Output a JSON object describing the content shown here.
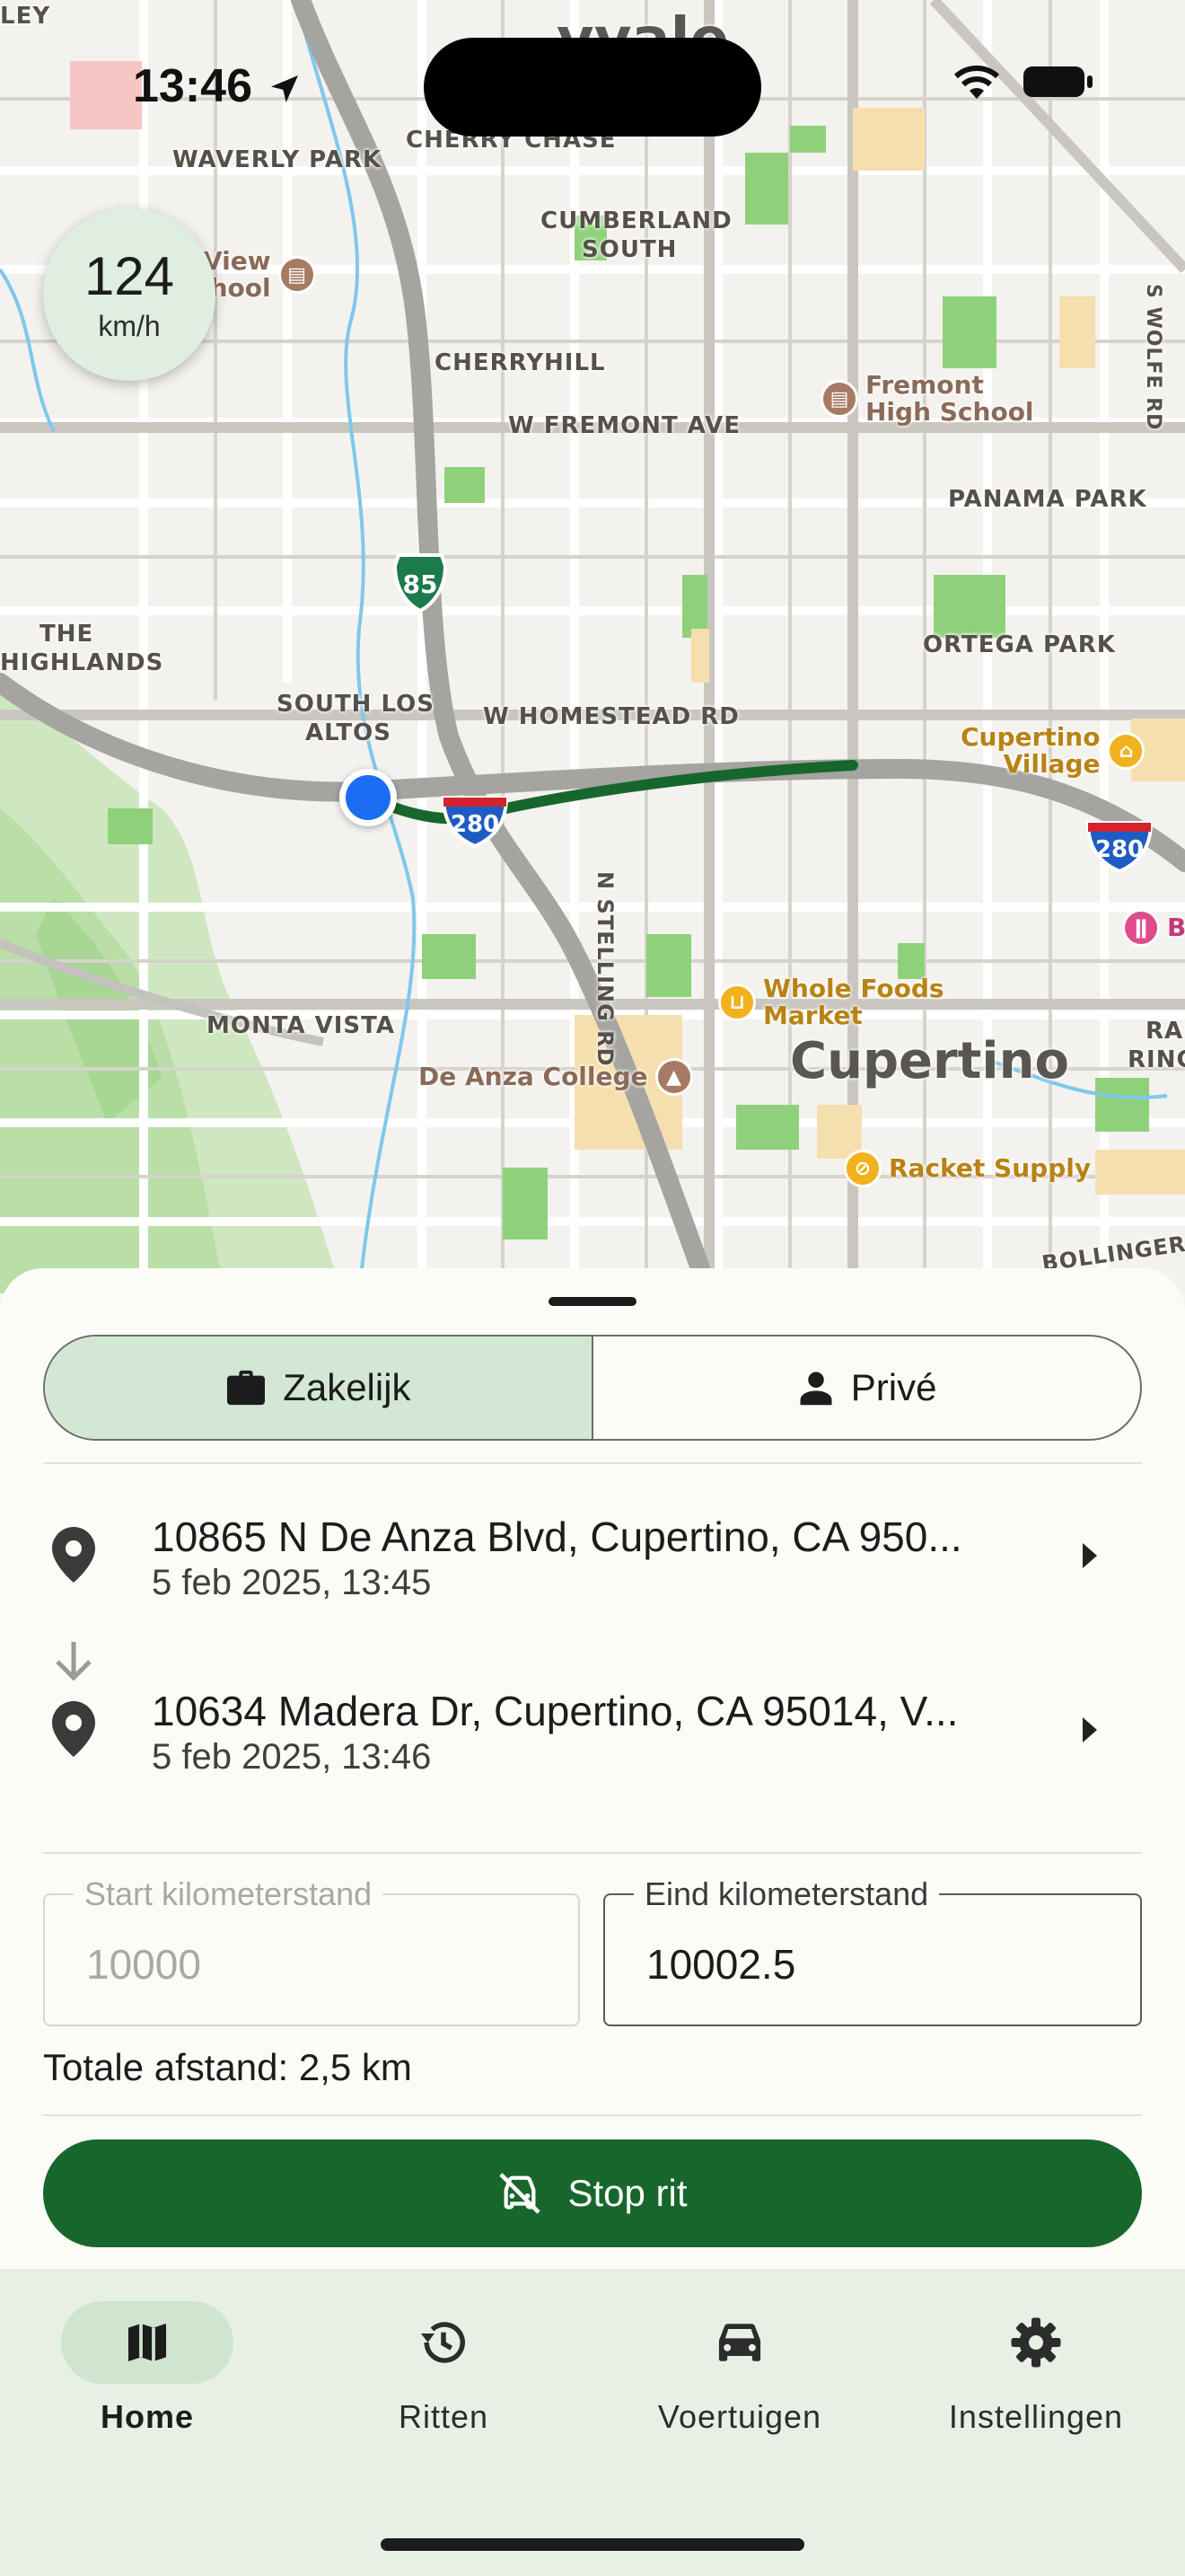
{
  "status_bar": {
    "time": "13:46",
    "icons": [
      "location-arrow-icon",
      "wifi-icon",
      "battery-icon"
    ]
  },
  "map": {
    "labels": {
      "sunnyvale": "yvale",
      "waverly_park": "WAVERLY PARK",
      "cherry_chase": "CHERRY CHASE",
      "cumberland": "CUMBERLAND",
      "cumberland_south": "SOUTH",
      "cherryhill": "CHERRYHILL",
      "fremont_ave": "W FREMONT AVE",
      "panama_park": "PANAMA PARK",
      "the": "THE",
      "highlands": "HIGHLANDS",
      "ortega_park": "ORTEGA PARK",
      "south_los": "SOUTH LOS",
      "altos": "ALTOS",
      "homestead_rd": "W HOMESTEAD RD",
      "stelling_rd": "N STELLING RD",
      "monta_vista": "MONTA VISTA",
      "cupertino": "Cupertino",
      "wolfe_rd": "S WOLFE RD",
      "rainbow": "RAI",
      "rinc": "RINC",
      "bollinger": "BOLLINGER",
      "ley": "LEY"
    },
    "pois": {
      "view_school_1": "View",
      "view_school_2": "hool",
      "fremont_hs_1": "Fremont",
      "fremont_hs_2": "High School",
      "cupertino_village_1": "Cupertino",
      "cupertino_village_2": "Village",
      "whole_foods_1": "Whole Foods",
      "whole_foods_2": "Market",
      "de_anza": "De Anza College",
      "racket_supply": "Racket Supply",
      "pink_b": "B"
    },
    "shields": {
      "hwy85": "85",
      "i280_a": "280",
      "i280_b": "280"
    },
    "colors": {
      "route": "#17672d",
      "location": "#1b6ef3",
      "park": "#8fd17a"
    }
  },
  "speed": {
    "value": "124",
    "unit": "km/h"
  },
  "trip_type": {
    "business_label": "Zakelijk",
    "private_label": "Privé",
    "selected": "business"
  },
  "start": {
    "address": "10865 N De Anza Blvd, Cupertino, CA 950...",
    "datetime": "5 feb 2025, 13:45"
  },
  "end": {
    "address": "10634 Madera Dr, Cupertino, CA 95014, V...",
    "datetime": "5 feb 2025, 13:46"
  },
  "odometer": {
    "start_label": "Start kilometerstand",
    "start_placeholder": "10000",
    "end_label": "Eind kilometerstand",
    "end_value": "10002.5"
  },
  "total_distance": "Totale afstand: 2,5 km",
  "stop_button": "Stop rit",
  "tabs": [
    {
      "label": "Home",
      "icon": "map-icon",
      "active": true
    },
    {
      "label": "Ritten",
      "icon": "history-icon",
      "active": false
    },
    {
      "label": "Voertuigen",
      "icon": "car-icon",
      "active": false
    },
    {
      "label": "Instellingen",
      "icon": "gear-icon",
      "active": false
    }
  ],
  "accent_color": "#17672d"
}
